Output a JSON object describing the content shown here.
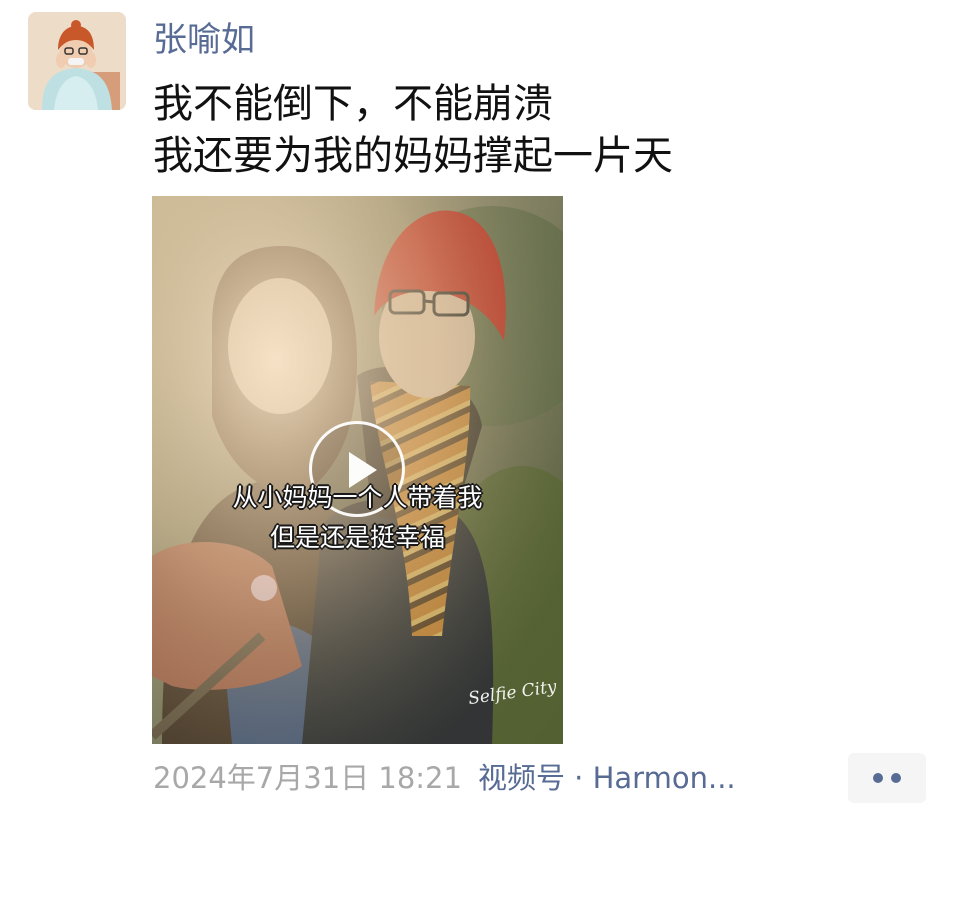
{
  "post": {
    "author": "张喻如",
    "text_lines": [
      "我不能倒下，不能崩溃",
      "我还要为我的妈妈撑起一片天"
    ],
    "video": {
      "captions": [
        "从小妈妈一个人带着我",
        "但是还是挺幸福"
      ],
      "watermark": "Selfie City",
      "play_icon": "play-icon"
    },
    "meta": {
      "time": "2024年7月31日 18:21",
      "source": "视频号 · Harmon..."
    },
    "more_icon": "more-dots-icon",
    "colors": {
      "link": "#576b95",
      "time": "#a8a8a8",
      "text": "#111111",
      "more_bg": "#f5f5f5"
    }
  }
}
